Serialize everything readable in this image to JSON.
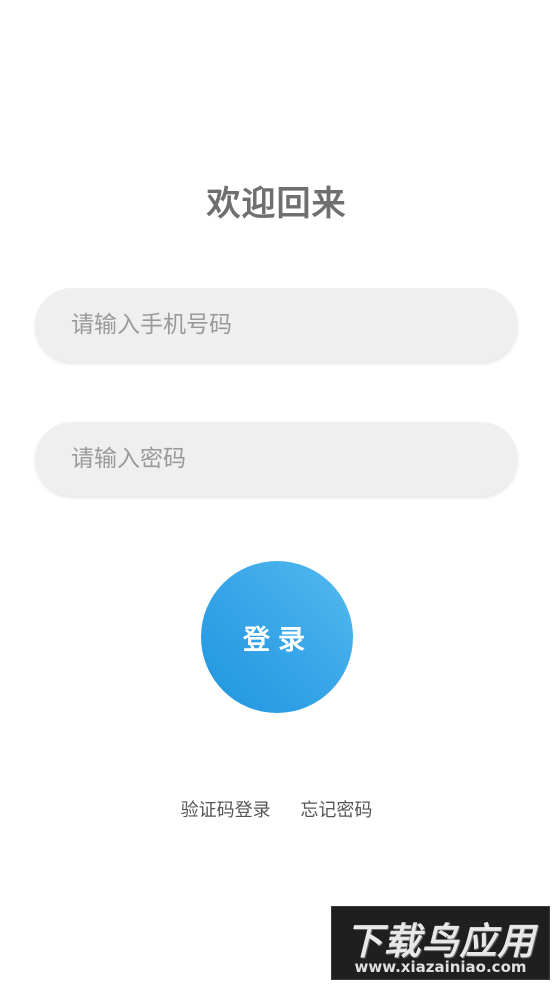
{
  "login": {
    "title": "欢迎回来",
    "phone_placeholder": "请输入手机号码",
    "password_placeholder": "请输入密码",
    "login_button": "登录",
    "sms_login_link": "验证码登录",
    "forgot_password_link": "忘记密码"
  },
  "watermark": {
    "text": "下载鸟应用",
    "url": "www.xiazainiao.com"
  },
  "colors": {
    "accent": "#2ea0e6",
    "title": "#6f6f6f",
    "field_bg": "#efefef"
  }
}
